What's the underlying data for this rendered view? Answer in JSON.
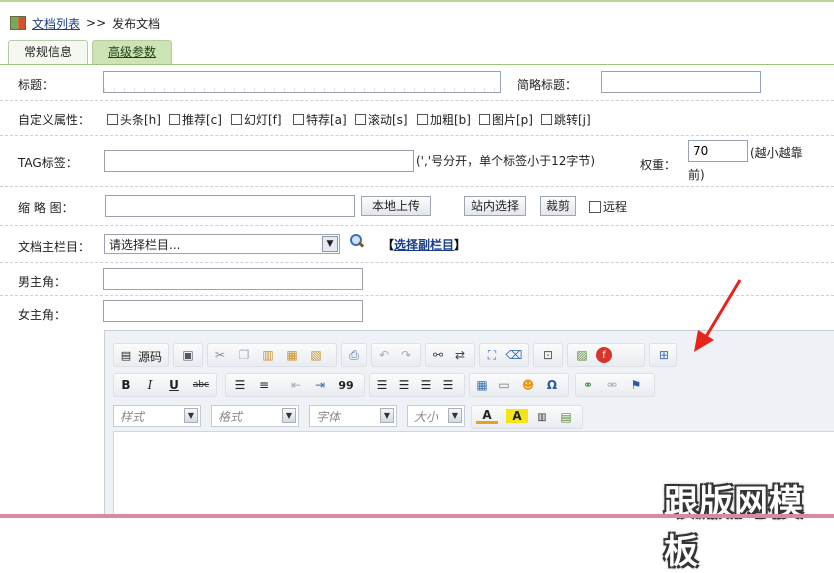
{
  "breadcrumb": {
    "list_link": "文档列表",
    "sep": ">>",
    "current": "发布文档"
  },
  "tabs": [
    {
      "label": "常规信息"
    },
    {
      "label": "高级参数"
    }
  ],
  "form": {
    "title_label": "标题：",
    "short_title_label": "简略标题：",
    "custom_attr_label": "自定义属性：",
    "attrs": [
      "头条[h]",
      "推荐[c]",
      "幻灯[f]",
      "特荐[a]",
      "滚动[s]",
      "加粗[b]",
      "图片[p]",
      "跳转[j]"
    ],
    "tag_label": "TAG标签：",
    "tag_hint": "(','号分开，单个标签小于12字节)",
    "weight_label": "权重：",
    "weight_value": "70",
    "weight_hint_1": "(越小越靠",
    "weight_hint_2": "前)",
    "thumb_label": "缩 略 图：",
    "upload_btn": "本地上传",
    "site_select_btn": "站内选择",
    "crop_btn": "裁剪",
    "remote_label": "远程",
    "column_label": "文档主栏目：",
    "column_select": "请选择栏目...",
    "sub_column_prefix": "【",
    "sub_column_link": "选择副栏目",
    "sub_column_suffix": "】",
    "male_label": "男主角：",
    "female_label": "女主角："
  },
  "editor": {
    "source_label": "源码",
    "combo_style": "样式",
    "combo_format": "格式",
    "combo_font": "字体",
    "combo_size": "大小",
    "toolbar_row1": [
      "copy-doc-icon",
      "templates-icon",
      "cut-icon",
      "copy-icon",
      "paste-icon",
      "paste-text-icon",
      "paste-word-icon",
      "print-icon",
      "undo-icon",
      "redo-icon",
      "find-icon",
      "replace-icon",
      "select-all-icon",
      "remove-format-icon",
      "preview-icon",
      "image-icon",
      "flash-icon",
      "maximize-icon"
    ],
    "toolbar_row2": [
      "bold-icon",
      "italic-icon",
      "underline-icon",
      "strike-icon",
      "ordered-list-icon",
      "bullet-list-icon",
      "outdent-icon",
      "indent-icon",
      "blockquote-icon",
      "align-left-icon",
      "align-center-icon",
      "align-right-icon",
      "justify-icon",
      "table-icon",
      "hr-icon",
      "smiley-icon",
      "special-char-icon",
      "link-icon",
      "unlink-icon",
      "anchor-icon"
    ],
    "glyphs": {
      "bold": "B",
      "italic": "I",
      "underline": "U",
      "strike": "abc",
      "quote": "99",
      "omega": "Ω",
      "text_color": "A",
      "bg_color": "A"
    }
  },
  "watermark": "跟版网模板",
  "colors": {
    "accent_green": "#cde3b4",
    "link_blue": "#1a3d8a",
    "arrow_red": "#e8231a"
  }
}
